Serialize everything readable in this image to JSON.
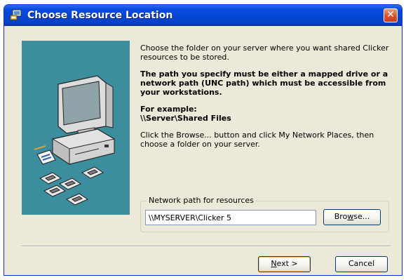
{
  "window": {
    "title": "Choose Resource Location",
    "close_glyph": "✕"
  },
  "content": {
    "intro": "Choose the folder on your server where you want shared Clicker resources to be stored.",
    "warning": "The path you specify must be either a mapped drive or a network path (UNC path) which must be accessible from your workstations.",
    "example_heading": "For example:",
    "example_path": "\\\\Server\\Shared Files",
    "instructions": "Click the Browse... button and click My Network Places, then choose a folder on your server."
  },
  "network_group": {
    "label": "Network path for resources",
    "path_value": "\\\\MYSERVER\\Clicker 5",
    "browse_label_pre": "Bro",
    "browse_label_accel": "w",
    "browse_label_post": "se..."
  },
  "footer": {
    "next_label_accel": "N",
    "next_label_post": "ext >",
    "cancel_label": "Cancel"
  },
  "colors": {
    "titlebar": "#0346d1",
    "panel": "#3c8d9e",
    "dialog_bg": "#ece9d8"
  },
  "icons": [
    "computer-icon",
    "floppy-disk-icon",
    "close-icon",
    "installer-app-icon"
  ]
}
